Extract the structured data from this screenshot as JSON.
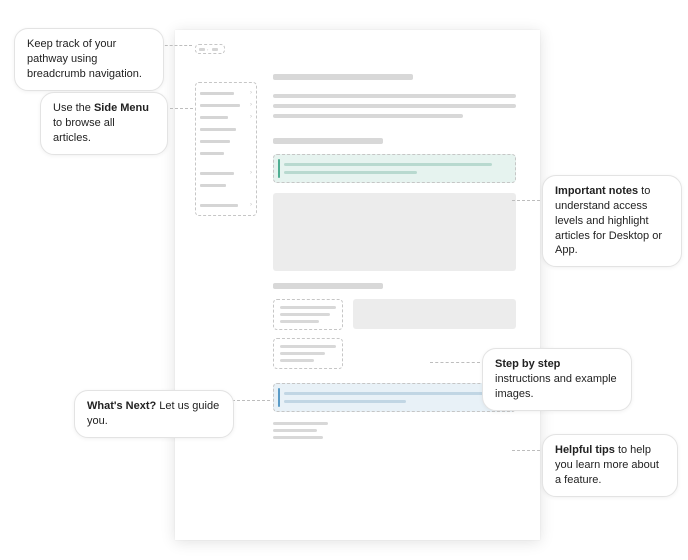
{
  "callouts": {
    "breadcrumb": {
      "pre": "Keep track of your pathway using ",
      "bold": "",
      "post": "breadcrumb navigation."
    },
    "sidemenu": {
      "pre": "Use the ",
      "bold": "Side Menu",
      "post": " to browse all articles."
    },
    "notes": {
      "pre": "",
      "bold": "Important notes",
      "post": " to understand access levels and highlight articles for Desktop or App."
    },
    "steps": {
      "pre": "",
      "bold": "Step by step",
      "post": " instructions and example images."
    },
    "whatsnext": {
      "pre": "",
      "bold": "What's Next?",
      "post": " Let us guide you."
    },
    "tips": {
      "pre": "",
      "bold": "Helpful tips",
      "post": " to help you learn more about a feature."
    }
  }
}
